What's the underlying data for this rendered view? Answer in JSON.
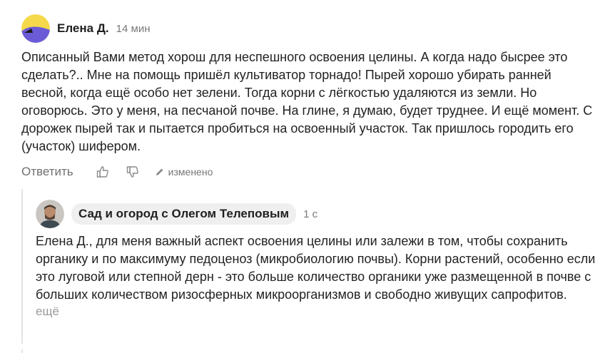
{
  "comment": {
    "author": "Елена Д.",
    "time": "14 мин",
    "text": "Описанный Вами метод хорош для неспешного освоения целины. А когда надо бысрее это сделать?.. Мне на помощь пришёл культиватор торнадо! Пырей хорошо убирать ранней весной, когда ещё особо нет зелени. Тогда корни с лёгкостью удаляются из земли. Но оговорюсь. Это у меня, на песчаной почве. На глине, я думаю, будет труднее. И ещё момент. С дорожек пырей так и пытается пробиться на освоенный участок. Так пришлось городить его (участок) шифером.",
    "reply_label": "Ответить",
    "edited_label": "изменено",
    "icons": [
      "like-icon",
      "dislike-icon",
      "pencil-icon"
    ]
  },
  "reply": {
    "author": "Сад и огород с Олегом Телеповым",
    "time": "1 с",
    "text": "Елена Д., для меня важный аспект освоения целины или залежи в том, чтобы сохранить органику и по максимуму педоценоз (микробиологию почвы). Корни растений, особенно если это луговой или степной дерн - это больше количество органики уже размещенной в почве с больших количеством ризосферных микроорганизмов и свободно живущих сапрофитов.",
    "more_label": "ещё"
  },
  "colors": {
    "avatar_yellow": "#f5d94a",
    "avatar_purple": "#6b5bd6",
    "muted_text": "#7a7a7a",
    "pill_bg": "#efefef"
  }
}
